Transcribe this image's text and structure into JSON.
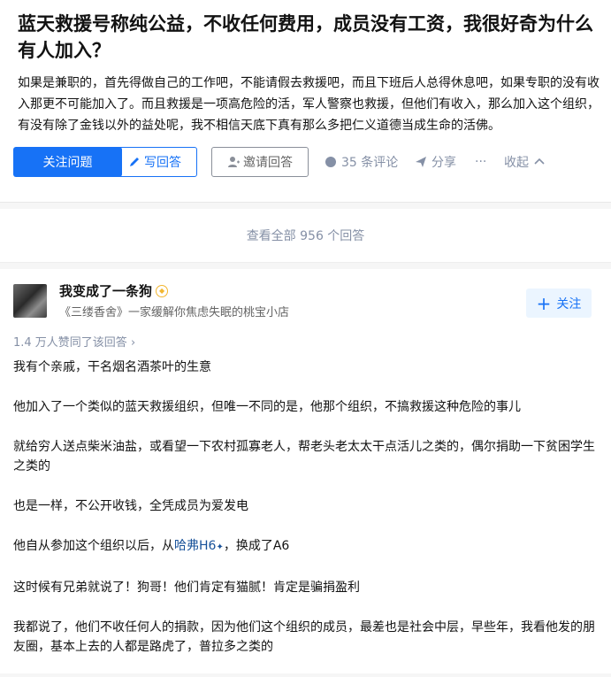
{
  "question": {
    "title": "蓝天救援号称纯公益，不收任何费用，成员没有工资，我很好奇为什么有人加入？",
    "description": "如果是兼职的，首先得做自己的工作吧，不能请假去救援吧，而且下班后人总得休息吧，如果专职的没有收入那更不可能加入了。而且救援是一项高危险的活，军人警察也救援，但他们有收入，那么加入这个组织，有没有除了金钱以外的益处呢，我不相信天底下真有那么多把仁义道德当成生命的活佛。"
  },
  "actions": {
    "follow_question": "关注问题",
    "write_answer": "写回答",
    "invite_answer": "邀请回答",
    "comments": "35 条评论",
    "share": "分享",
    "more": "···",
    "collapse": "收起"
  },
  "view_all": "查看全部 956 个回答",
  "answer": {
    "author_name": "我变成了一条狗",
    "author_bio": "《三缕香舍》一家缓解你焦虑失眠的桃宝小店",
    "follow_label": "关注",
    "votes": "1.4 万人赞同了该回答",
    "paragraphs": [
      "我有个亲戚，干名烟名酒茶叶的生意",
      "他加入了一个类似的蓝天救援组织，但唯一不同的是，他那个组织，不搞救援这种危险的事儿",
      "就给穷人送点柴米油盐，或看望一下农村孤寡老人，帮老头老太太干点活儿之类的，偶尔捐助一下贫困学生之类的",
      "也是一样，不公开收钱，全凭成员为爱发电"
    ],
    "p5_before": "他自从参加这个组织以后，从",
    "p5_link": "哈弗H6",
    "p5_after": "，换成了A6",
    "paragraphs2": [
      "这时候有兄弟就说了！狗哥！他们肯定有猫腻！肯定是骗捐盈利",
      "我都说了，他们不收任何人的捐款，因为他们这个组织的成员，最差也是社会中层，早些年，我看他发的朋友圈，基本上去的人都是路虎了，普拉多之类的"
    ]
  },
  "colors": {
    "brand_blue": "#1772f6",
    "muted": "#8590a6",
    "link": "#175199"
  }
}
